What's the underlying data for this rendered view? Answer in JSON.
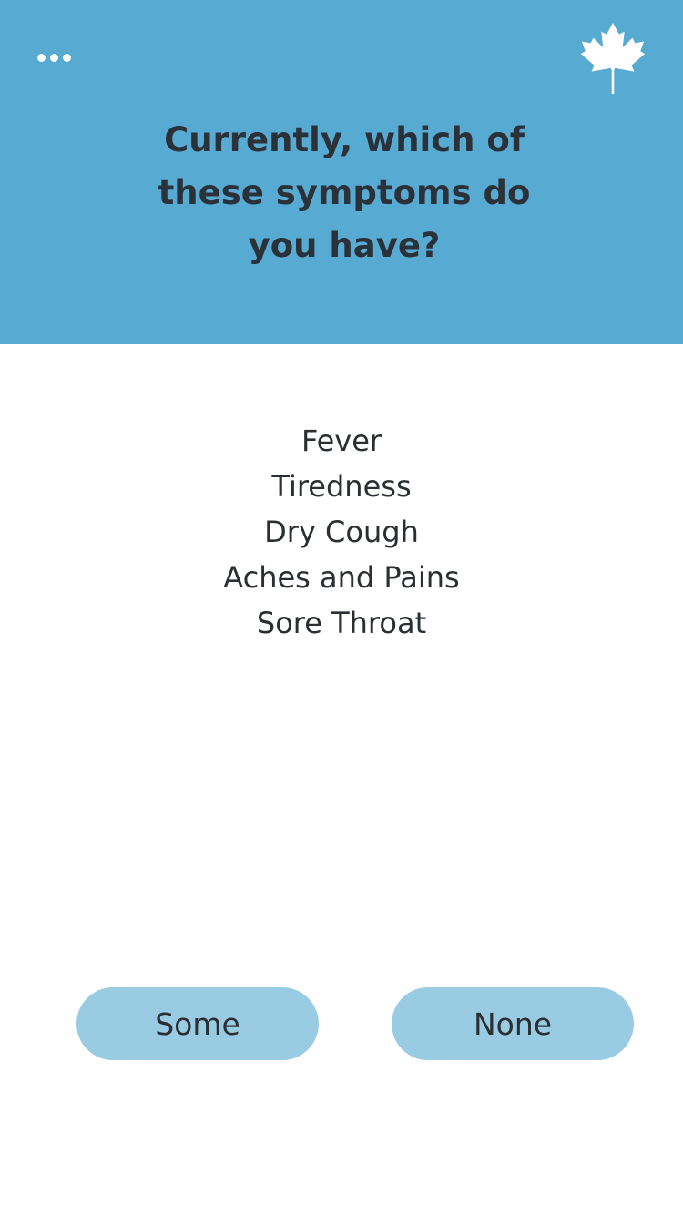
{
  "header": {
    "menu_icon": "ellipsis-icon",
    "logo_icon": "maple-leaf-icon",
    "question": "Currently, which of\nthese symptoms do\nyou have?",
    "background_color": "#57aad2"
  },
  "symptoms": [
    "Fever",
    "Tiredness",
    "Dry Cough",
    "Aches and Pains",
    "Sore Throat"
  ],
  "answers": {
    "some_label": "Some",
    "none_label": "None",
    "button_color": "#99cbe2"
  }
}
